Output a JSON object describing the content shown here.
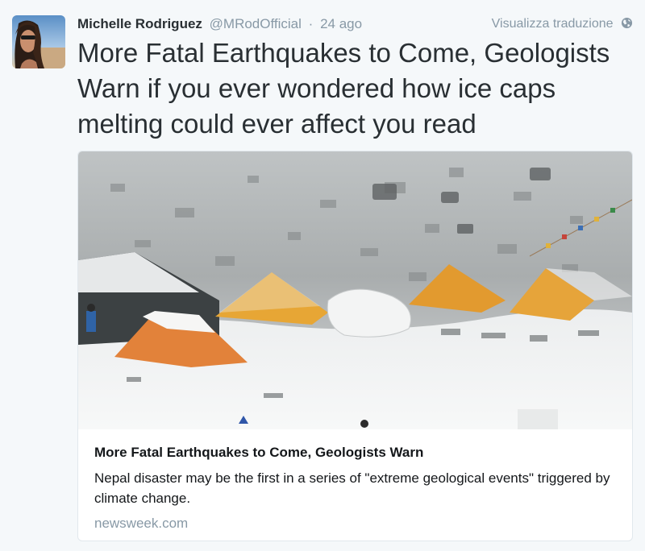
{
  "tweet": {
    "author": {
      "name": "Michelle Rodriguez",
      "handle": "@MRodOfficial",
      "avatar_icon": "profile-photo"
    },
    "separator": "·",
    "timestamp": "24 ago",
    "translate_label": "Visualizza traduzione",
    "translate_icon": "globe-icon",
    "text": "More Fatal Earthquakes to Come, Geologists Warn if you ever wondered how ice caps melting could ever affect you read"
  },
  "card": {
    "image_icon": "snowy-campsite-photo",
    "title": "More Fatal Earthquakes to Come, Geologists Warn",
    "description": "Nepal disaster may be the first in a series of \"extreme geological events\" triggered by climate change.",
    "domain": "newsweek.com"
  },
  "colors": {
    "secondary_text": "#8899a6",
    "primary_text": "#292f33",
    "card_border": "#e1e8ed",
    "background": "#f5f8fa"
  }
}
